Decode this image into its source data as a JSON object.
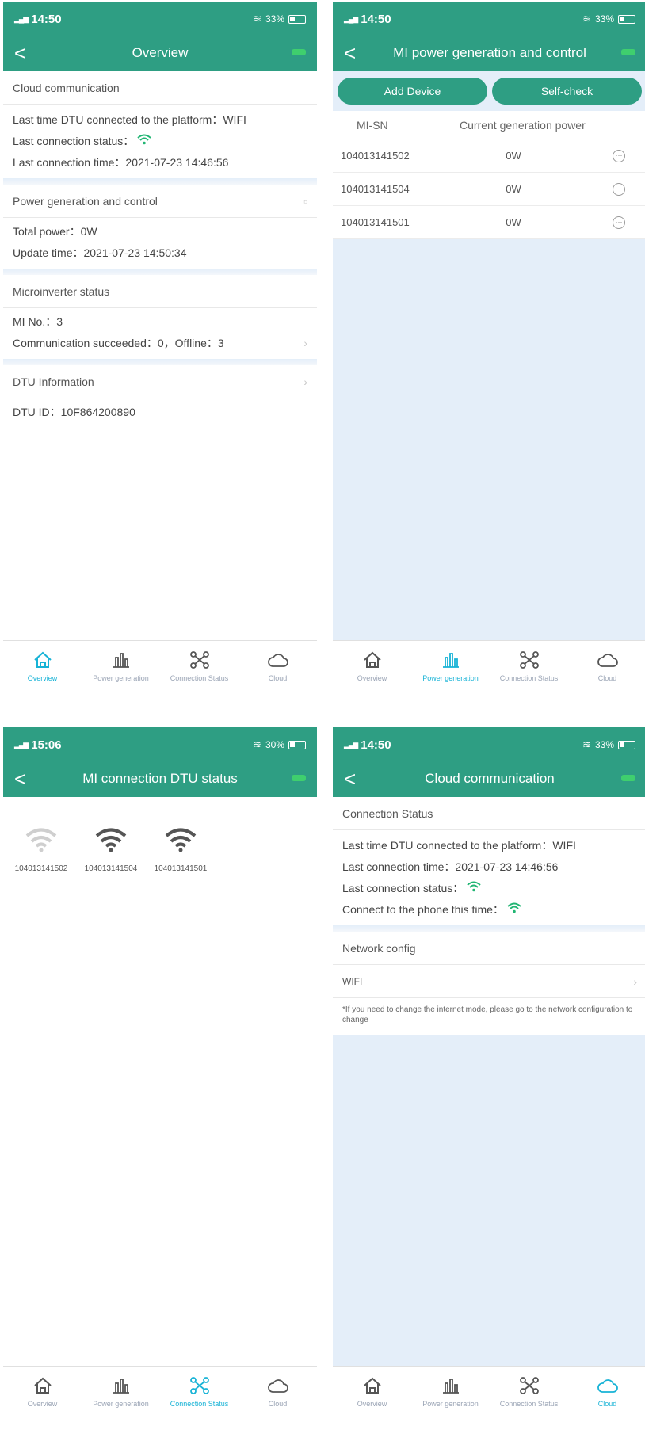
{
  "status_bars": [
    {
      "time": "14:50",
      "battery": "33%"
    },
    {
      "time": "14:50",
      "battery": "33%"
    },
    {
      "time": "15:06",
      "battery": "30%"
    },
    {
      "time": "14:50",
      "battery": "33%"
    }
  ],
  "tabs": {
    "overview": "Overview",
    "power": "Power generation",
    "connection": "Connection Status",
    "cloud": "Cloud"
  },
  "overview": {
    "title": "Overview",
    "cloud_section": "Cloud communication",
    "last_dtu": "Last time DTU connected to the platform：WIFI",
    "last_status": "Last connection status：",
    "last_time": "Last connection time：2021-07-23 14:46:56",
    "power_section": "Power generation and control",
    "total_power": "Total power：0W",
    "update_time": "Update time：2021-07-23 14:50:34",
    "mi_section": "Microinverter status",
    "mi_no": "MI No.：3",
    "comm": "Communication succeeded：0，Offline：3",
    "dtu_section": "DTU Information",
    "dtu_id": "DTU ID：10F864200890"
  },
  "power": {
    "title": "MI power generation and control",
    "add_device": "Add Device",
    "self_check": "Self-check",
    "col_sn": "MI-SN",
    "col_power": "Current generation power",
    "rows": [
      {
        "sn": "104013141502",
        "power": "0W"
      },
      {
        "sn": "104013141504",
        "power": "0W"
      },
      {
        "sn": "104013141501",
        "power": "0W"
      }
    ]
  },
  "connection": {
    "title": "MI connection DTU status",
    "devices": [
      {
        "sn": "104013141502",
        "state": "offline"
      },
      {
        "sn": "104013141504",
        "state": "online"
      },
      {
        "sn": "104013141501",
        "state": "online"
      }
    ]
  },
  "cloud": {
    "title": "Cloud communication",
    "status_section": "Connection Status",
    "last_dtu": "Last time DTU connected to the platform：WIFI",
    "last_time": "Last connection time：2021-07-23 14:46:56",
    "last_status": "Last connection status：",
    "phone": "Connect to the phone this time：",
    "net_section": "Network config",
    "wifi": "WIFI",
    "note": "*If you need to change the internet mode, please go to the network configuration to change"
  },
  "colors": {
    "header": "#2e9e83",
    "active_tab": "#18b3d6",
    "wifi_ok": "#21b573",
    "bg_tint": "#e4eef9"
  }
}
